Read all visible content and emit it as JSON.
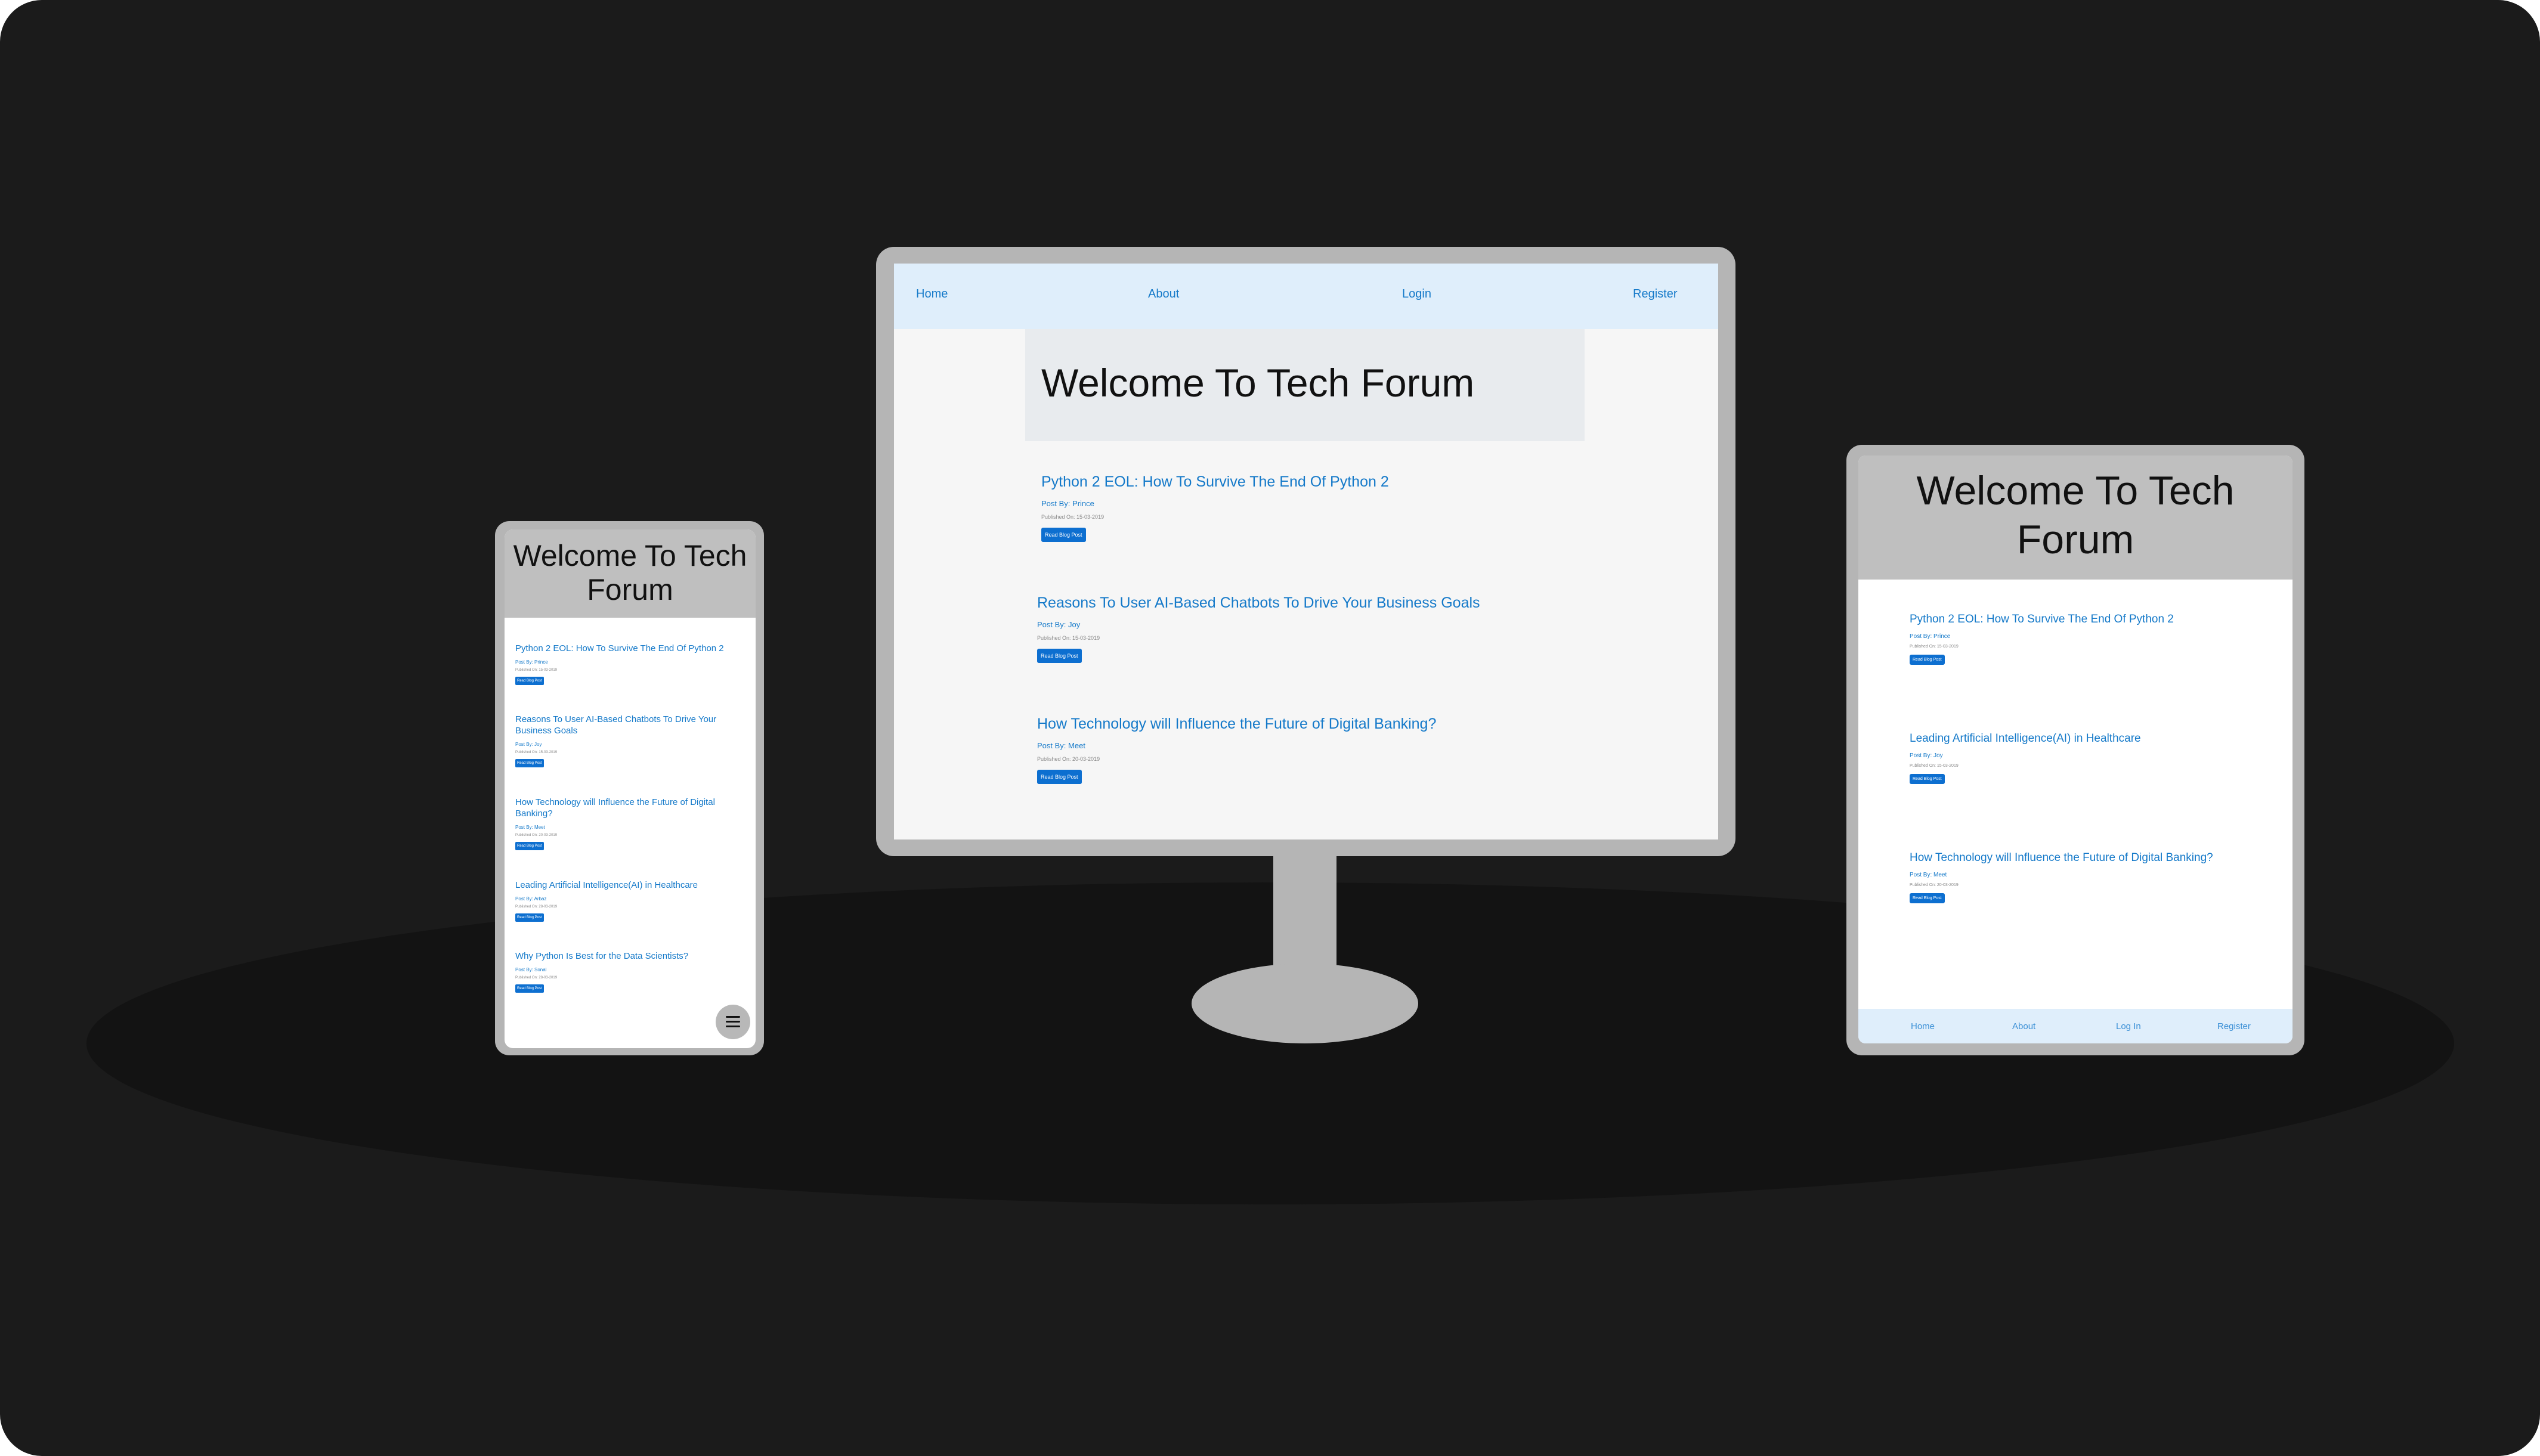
{
  "desktop": {
    "nav": [
      "Home",
      "About",
      "Login",
      "Register"
    ],
    "hero_title": "Welcome To Tech Forum",
    "posts": [
      {
        "title": "Python 2 EOL: How To Survive The End Of Python 2",
        "author": "Post By: Prince",
        "date": "Published On: 15-03-2019",
        "button": "Read Blog Post"
      },
      {
        "title": "Reasons To User AI-Based Chatbots To Drive Your Business Goals",
        "author": "Post By: Joy",
        "date": "Published On: 15-03-2019",
        "button": "Read Blog Post"
      },
      {
        "title": "How Technology will Influence the Future of Digital Banking?",
        "author": "Post By: Meet",
        "date": "Published On: 20-03-2019",
        "button": "Read Blog Post"
      }
    ]
  },
  "phone": {
    "hero_title": "Welcome To Tech Forum",
    "menu_icon": "hamburger-menu-icon",
    "posts": [
      {
        "title": "Python 2 EOL: How To Survive The End Of Python 2",
        "author": "Post By: Prince",
        "date": "Published On: 15-03-2019",
        "button": "Read Blog Post"
      },
      {
        "title": "Reasons To User AI-Based Chatbots To Drive Your Business Goals",
        "author": "Post By: Joy",
        "date": "Published On: 15-03-2019",
        "button": "Read Blog Post"
      },
      {
        "title": "How Technology will Influence the Future of Digital Banking?",
        "author": "Post By: Meet",
        "date": "Published On: 20-03-2019",
        "button": "Read Blog Post"
      },
      {
        "title": "Leading Artificial Intelligence(AI) in Healthcare",
        "author": "Post By: Arbaz",
        "date": "Published On: 28-03-2019",
        "button": "Read Blog Post"
      },
      {
        "title": "Why Python Is Best for the Data Scientists?",
        "author": "Post By: Sonal",
        "date": "Published On: 28-03-2019",
        "button": "Read Blog Post"
      }
    ]
  },
  "tablet": {
    "hero_title": "Welcome To Tech Forum",
    "nav": [
      "Home",
      "About",
      "Log In",
      "Register"
    ],
    "posts": [
      {
        "title": "Python 2 EOL: How To Survive The End Of Python 2",
        "author": "Post By: Prince",
        "date": "Published On: 15-03-2019",
        "button": "Read Blog Post"
      },
      {
        "title": "Leading Artificial Intelligence(AI) in Healthcare",
        "author": "Post By: Joy",
        "date": "Published On: 15-03-2019",
        "button": "Read Blog Post"
      },
      {
        "title": "How Technology will Influence the Future of Digital Banking?",
        "author": "Post By: Meet",
        "date": "Published On: 20-03-2019",
        "button": "Read Blog Post"
      }
    ]
  },
  "colors": {
    "background": "#1b1b1b",
    "device_frame": "#b5b5b5",
    "link": "#1479c9",
    "button": "#0d6fd0",
    "nav_bar": "#dfeefb"
  }
}
